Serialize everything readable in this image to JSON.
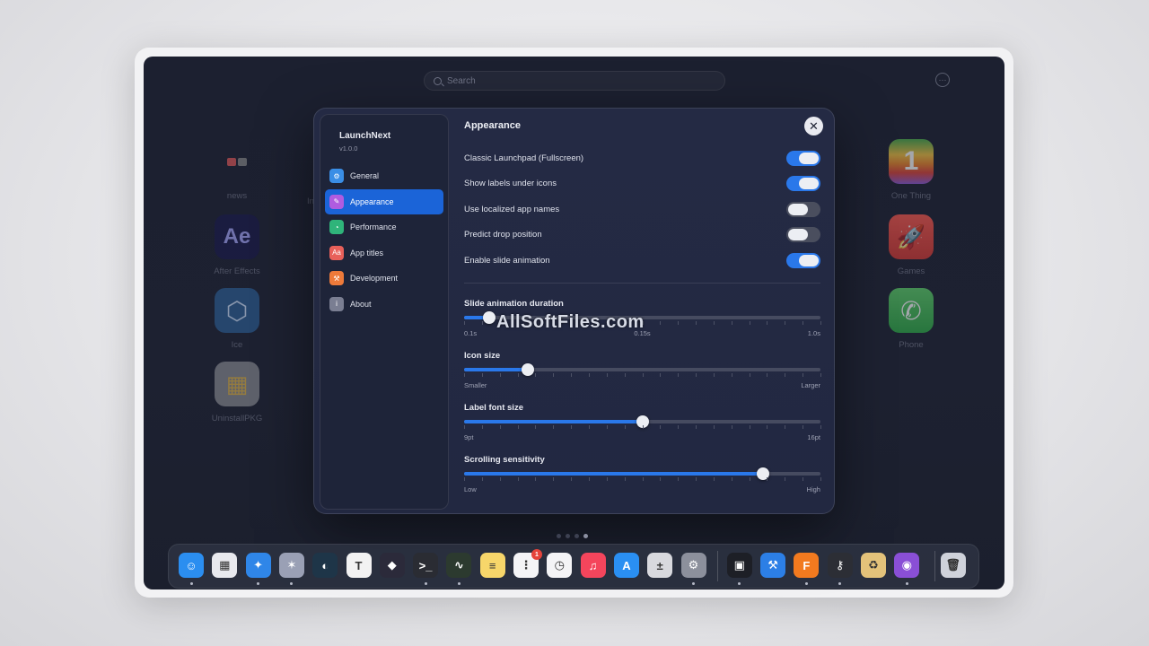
{
  "launchpad": {
    "search_placeholder": "Search",
    "apps_left": [
      {
        "label": "news",
        "icon": "news-icon",
        "glyph": ""
      },
      {
        "label": "After Effects",
        "icon": "after-effects-icon",
        "glyph": "Ae"
      },
      {
        "label": "Ice",
        "icon": "ice-icon",
        "glyph": "⬡"
      },
      {
        "label": "UninstallPKG",
        "icon": "uninstallpkg-icon",
        "glyph": "▦"
      }
    ],
    "apps_right": [
      {
        "label": "One Thing",
        "icon": "one-thing-icon",
        "glyph": "1"
      },
      {
        "label": "Games",
        "icon": "games-icon",
        "glyph": "🚀"
      },
      {
        "label": "Phone",
        "icon": "phone-icon",
        "glyph": "✆"
      }
    ],
    "partial_label": "In"
  },
  "dialog": {
    "app_name": "LaunchNext",
    "version": "v1.0.0",
    "nav": [
      {
        "label": "General",
        "icon": "gear-icon",
        "color": "#3a8ee6",
        "active": false
      },
      {
        "label": "Appearance",
        "icon": "paintbrush-icon",
        "color": "#b05ce0",
        "active": true
      },
      {
        "label": "Performance",
        "icon": "gauge-icon",
        "color": "#2fb47a",
        "active": false
      },
      {
        "label": "App titles",
        "icon": "text-format-icon",
        "color": "#e8605a",
        "active": false
      },
      {
        "label": "Development",
        "icon": "hammer-icon",
        "color": "#ee7a3a",
        "active": false
      },
      {
        "label": "About",
        "icon": "info-icon",
        "color": "#7a7e92",
        "active": false
      }
    ],
    "title": "Appearance",
    "toggles": [
      {
        "label": "Classic Launchpad (Fullscreen)",
        "on": true
      },
      {
        "label": "Show labels under icons",
        "on": true
      },
      {
        "label": "Use localized app names",
        "on": false
      },
      {
        "label": "Predict drop position",
        "on": false
      },
      {
        "label": "Enable slide animation",
        "on": true
      }
    ],
    "sliders": [
      {
        "label": "Slide animation duration",
        "value": 0.07,
        "min_label": "0.1s",
        "mid_label": "0.15s",
        "max_label": "1.0s"
      },
      {
        "label": "Icon size",
        "value": 0.18,
        "min_label": "Smaller",
        "mid_label": "",
        "max_label": "Larger"
      },
      {
        "label": "Label font size",
        "value": 0.5,
        "min_label": "9pt",
        "mid_label": "",
        "max_label": "16pt"
      },
      {
        "label": "Scrolling sensitivity",
        "value": 0.84,
        "min_label": "Low",
        "mid_label": "",
        "max_label": "High"
      }
    ]
  },
  "watermark": "AllSoftFiles.com",
  "dock": [
    {
      "icon": "finder-icon",
      "glyph": "☺",
      "color": "#2b8ef0",
      "running": true
    },
    {
      "icon": "launchpad-icon",
      "glyph": "▦",
      "color": "#e8e9ee",
      "running": false
    },
    {
      "icon": "safari-icon",
      "glyph": "✦",
      "color": "#2f86e8",
      "running": true
    },
    {
      "icon": "testflight-icon",
      "glyph": "✶",
      "color": "#9aa0b5",
      "running": true
    },
    {
      "icon": "cleanup-icon",
      "glyph": "◐",
      "color": "#1e3548",
      "running": false
    },
    {
      "icon": "typora-icon",
      "glyph": "T",
      "color": "#f2f2f2",
      "running": false
    },
    {
      "icon": "obsidian-icon",
      "glyph": "◆",
      "color": "#2b2a3a",
      "running": false
    },
    {
      "icon": "terminal-icon",
      "glyph": ">_",
      "color": "#2a2c33",
      "running": true
    },
    {
      "icon": "activity-monitor-icon",
      "glyph": "∿",
      "color": "#2c3a2f",
      "running": true
    },
    {
      "icon": "notes-icon",
      "glyph": "≡",
      "color": "#f7d66a",
      "running": false
    },
    {
      "icon": "reminders-icon",
      "glyph": "⋮",
      "color": "#f4f4f6",
      "running": false,
      "badge": "1"
    },
    {
      "icon": "clock-icon",
      "glyph": "◷",
      "color": "#f4f4f6",
      "running": false
    },
    {
      "icon": "music-icon",
      "glyph": "♫",
      "color": "#f4455c",
      "running": false
    },
    {
      "icon": "app-store-icon",
      "glyph": "A",
      "color": "#2a8ff2",
      "running": false
    },
    {
      "icon": "calculator-icon",
      "glyph": "±",
      "color": "#d8d9de",
      "running": false
    },
    {
      "icon": "system-settings-icon",
      "glyph": "⚙",
      "color": "#8c909c",
      "running": true
    },
    {
      "icon": "parallels-icon",
      "glyph": "▣",
      "color": "#1d1f26",
      "running": true
    },
    {
      "icon": "xcode-icon",
      "glyph": "⚒",
      "color": "#2c7fe6",
      "running": false
    },
    {
      "icon": "fileplus-icon",
      "glyph": "F",
      "color": "#f27a1f",
      "running": true
    },
    {
      "icon": "keychain-icon",
      "glyph": "⚷",
      "color": "#2c2e35",
      "running": true
    },
    {
      "icon": "archive-utility-icon",
      "glyph": "♻",
      "color": "#e3c27a",
      "running": false
    },
    {
      "icon": "github-icon",
      "glyph": "◉",
      "color": "#8a4fd6",
      "running": true
    },
    {
      "icon": "trash-icon",
      "glyph": "🗑",
      "color": "#cfd2da",
      "running": false
    }
  ]
}
